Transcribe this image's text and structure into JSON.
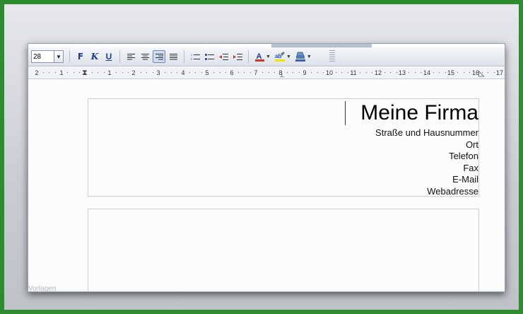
{
  "toolbar": {
    "font_size_value": "28",
    "bold_label": "F",
    "italic_label": "K",
    "underline_label": "U"
  },
  "ruler": {
    "labels": [
      "2",
      "1",
      "1",
      "2",
      "3",
      "4",
      "5",
      "6",
      "7",
      "8",
      "9",
      "10",
      "11",
      "12",
      "13",
      "14",
      "15",
      "16",
      "17"
    ]
  },
  "document": {
    "company_name": "Meine Firma",
    "address_lines": [
      "Straße und Hausnummer",
      "Ort",
      "Telefon",
      "Fax",
      "E-Mail",
      "Webadresse"
    ]
  },
  "watermark": "Vorlagen",
  "colors": {
    "font_color": "#1f3a9a",
    "highlight": "#f2e600",
    "frame": "#2e8b2e"
  },
  "icons": [
    "align-left-icon",
    "align-center-icon",
    "align-right-icon",
    "justify-icon",
    "numbered-list-icon",
    "bullet-list-icon",
    "decrease-indent-icon",
    "increase-indent-icon",
    "font-color-icon",
    "highlight-icon",
    "background-color-icon"
  ]
}
